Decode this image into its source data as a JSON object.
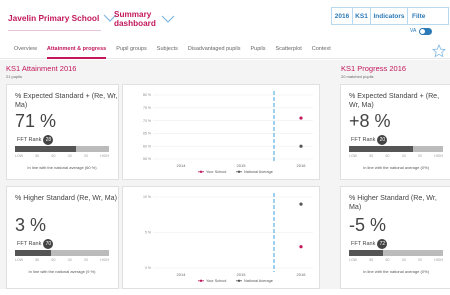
{
  "header": {
    "school_name": "Javelin Primary School",
    "dashboard_name": "Summary dashboard",
    "year": "2016",
    "key_stage": "KS1",
    "indicators": "Indicators",
    "filter": "Filte",
    "va_label": "VA"
  },
  "nav": {
    "tabs": [
      "Overview",
      "Attainment & progress",
      "Pupil groups",
      "Subjects",
      "Disadvantaged pupils",
      "Pupils",
      "Scatterplot",
      "Context"
    ],
    "active": "Attainment & progress"
  },
  "attainment": {
    "title": "KS1 Attainment 2016",
    "subtitle": "21 pupils",
    "expected": {
      "title": "% Expected Standard + (Re, Wr, Ma)",
      "value": "71 %",
      "rank_label": "FFT Rank",
      "rank": "28",
      "inline_text": "In line with the national average (60 %)"
    },
    "higher": {
      "title": "% Higher Standard (Re, Wr, Ma)",
      "value": "3 %",
      "rank_label": "FFT Rank",
      "rank": "70",
      "inline_text": "In line with the national average (9 %)"
    },
    "scale": [
      "LOW",
      "80",
      "60",
      "40",
      "20",
      "HIGH"
    ]
  },
  "progress": {
    "title": "KS1 Progress 2016",
    "subtitle": "20 matched pupils",
    "expected": {
      "title": "% Expected Standard + (Re, Wr, Ma)",
      "value": "+8 %",
      "rank_label": "FFT Rank",
      "rank": "20",
      "inline_text": "In line with the national average (0%)"
    },
    "higher": {
      "title": "% Higher Standard (Re, Wr, Ma)",
      "value": "-5 %",
      "rank_label": "FFT Rank",
      "rank": "72",
      "inline_text": "In line with the national average (0%)"
    }
  },
  "chart_legend": {
    "school": "Your School",
    "national": "National Average"
  },
  "colors": {
    "accent": "#c2185b",
    "blue": "#2b79b6",
    "dashed": "#5ab4e5"
  },
  "chart_data": [
    {
      "type": "scatter",
      "title": "",
      "categories": [
        "2014",
        "2015",
        "2016"
      ],
      "y_ticks": [
        "80 %",
        "75 %",
        "70 %",
        "65 %",
        "60 %",
        "55 %"
      ],
      "ylim": [
        55,
        80
      ],
      "series": [
        {
          "name": "Your School",
          "values": [
            null,
            null,
            71
          ]
        },
        {
          "name": "National Average",
          "values": [
            null,
            null,
            60
          ]
        }
      ]
    },
    {
      "type": "scatter",
      "title": "",
      "categories": [
        "2014",
        "2015",
        "2016"
      ],
      "y_ticks": [
        "10 %",
        "5 %",
        "0 %"
      ],
      "ylim": [
        0,
        10
      ],
      "series": [
        {
          "name": "Your School",
          "values": [
            null,
            null,
            3
          ]
        },
        {
          "name": "National Average",
          "values": [
            null,
            null,
            9
          ]
        }
      ]
    }
  ]
}
